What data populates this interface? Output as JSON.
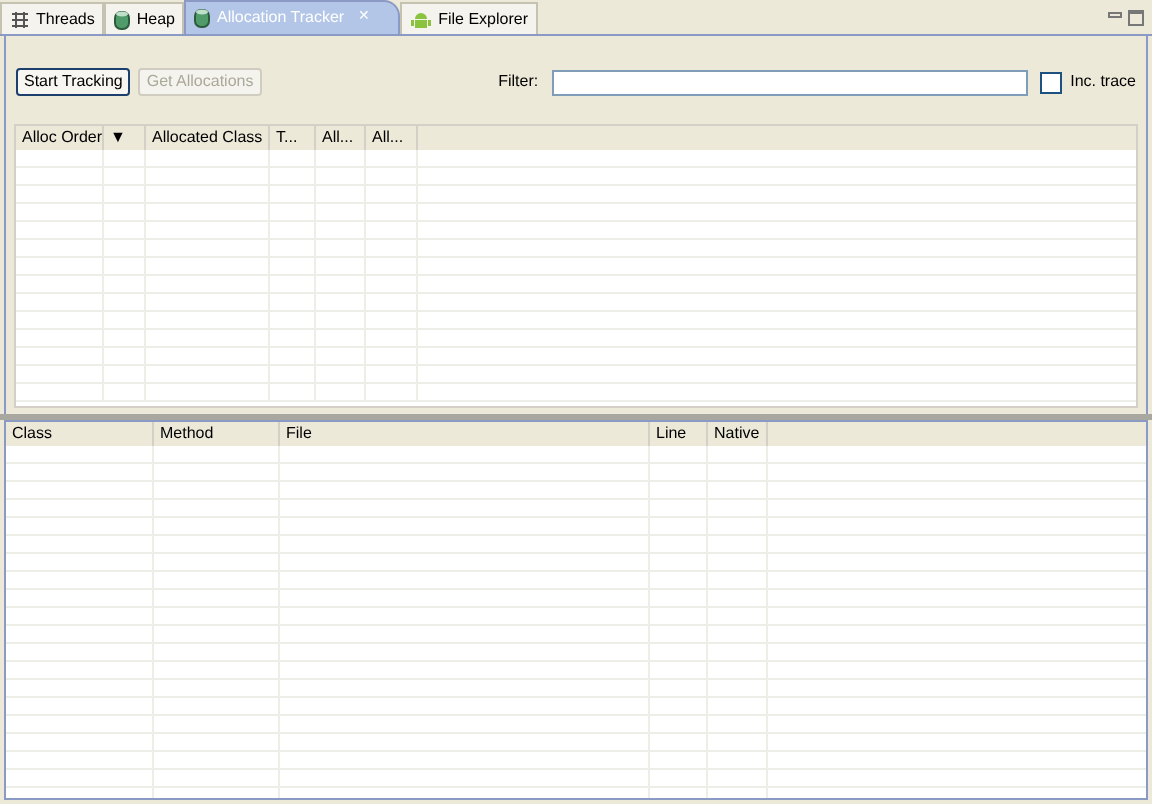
{
  "tabs": [
    {
      "label": "Threads",
      "kind": "threads",
      "selected": false
    },
    {
      "label": "Heap",
      "kind": "heap",
      "selected": false
    },
    {
      "label": "Allocation Tracker",
      "kind": "heap",
      "selected": true,
      "close": "✕"
    },
    {
      "label": "File Explorer",
      "kind": "android",
      "selected": false
    }
  ],
  "toolbar": {
    "buttons": [
      {
        "label": "Start Tracking",
        "disabled": false
      },
      {
        "label": "Get Allocations",
        "disabled": true
      }
    ],
    "filter": {
      "label": "Filter:"
    },
    "inc_trace": {
      "label": "Inc. trace",
      "checked": false
    }
  },
  "allocations_table": {
    "columns": [
      "Alloc Order",
      "▼",
      "Allocated Class",
      "T...",
      "All...",
      "All..."
    ]
  },
  "stack_table": {
    "columns": [
      "Class",
      "Method",
      "File",
      "Line",
      "Native"
    ]
  }
}
